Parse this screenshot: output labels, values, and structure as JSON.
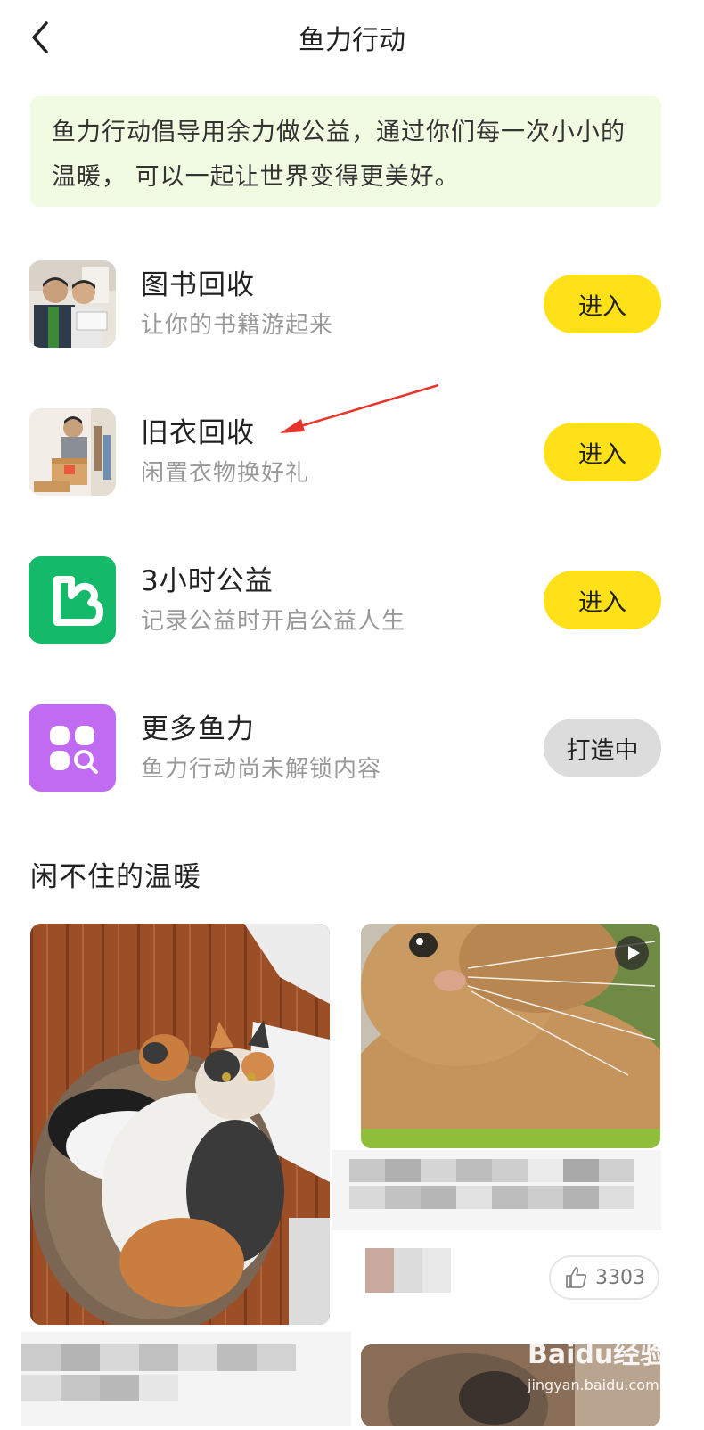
{
  "header": {
    "title": "鱼力行动"
  },
  "banner": {
    "text": "鱼力行动倡导用余力做公益，通过你们每一次小小的温暖， 可以一起让世界变得更美好。"
  },
  "actions": [
    {
      "title": "图书回收",
      "subtitle": "让你的书籍游起来",
      "button": "进入"
    },
    {
      "title": "旧衣回收",
      "subtitle": "闲置衣物换好礼",
      "button": "进入"
    },
    {
      "title": "3小时公益",
      "subtitle": "记录公益时开启公益人生",
      "button": "进入"
    },
    {
      "title": "更多鱼力",
      "subtitle": "鱼力行动尚未解锁内容",
      "button": "打造中"
    }
  ],
  "section": {
    "title": "闲不住的温暖"
  },
  "feed": {
    "like_count": "3303"
  },
  "watermark": {
    "brand": "Baidu经验",
    "sub": "jingyan.baidu.com"
  },
  "colors": {
    "accent": "#ffe11a",
    "banner_bg": "#f1fbe2",
    "green_icon": "#14b96a",
    "purple_icon": "#c06bf1"
  }
}
